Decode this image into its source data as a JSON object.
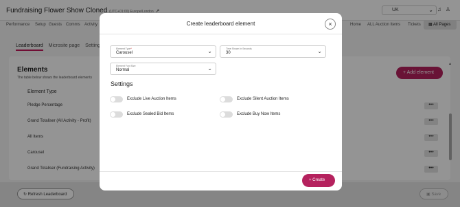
{
  "app": {
    "title": "Fundraising Flower Show Cloned",
    "timezone": "(UTC+01:00) Europe/London",
    "language": "UK"
  },
  "nav": {
    "left": [
      "Performance",
      "Setup",
      "Guests",
      "Comms",
      "Activity"
    ],
    "right": [
      "Home",
      "ALL Auction Items",
      "Tickets"
    ],
    "all_pages": "All Pages"
  },
  "subtabs": [
    "Leaderboard",
    "Microsite page",
    "Settings"
  ],
  "elements": {
    "title": "Elements",
    "description": "The table below shows the leaderboard elements",
    "add_button": "+ Add element",
    "column_header": "Element Type",
    "rows": [
      "Pledge Percentage",
      "Grand Totaliser (All Activity - Profit)",
      "All Items",
      "Carousel",
      "Grand Totaliser (Fundraising Activity)"
    ],
    "row_action": "•••"
  },
  "footer": {
    "refresh": "Refresh Leaderboard",
    "save": "Save"
  },
  "modal": {
    "title": "Create leaderboard element",
    "close": "×",
    "fields": {
      "element_type": {
        "label": "Element Type",
        "required": "*",
        "value": "Carousel"
      },
      "time_shown": {
        "label": "Time Shown In Seconds",
        "value": "30"
      },
      "font_size": {
        "label": "Element Font Size",
        "value": "Normal"
      }
    },
    "settings_title": "Settings",
    "toggles": {
      "exclude_live": {
        "label": "Exclude Live Auction Items",
        "on": false
      },
      "exclude_silent": {
        "label": "Exclude Silent Auction Items",
        "on": false
      },
      "exclude_sealed": {
        "label": "Exclude Sealed Bid Items",
        "on": false
      },
      "exclude_buy_now": {
        "label": "Exclude Buy Now Items",
        "on": false
      }
    },
    "create_button": "+ Create"
  },
  "colors": {
    "accent": "#b5225e",
    "overlay": "rgba(0,0,0,0.42)"
  }
}
